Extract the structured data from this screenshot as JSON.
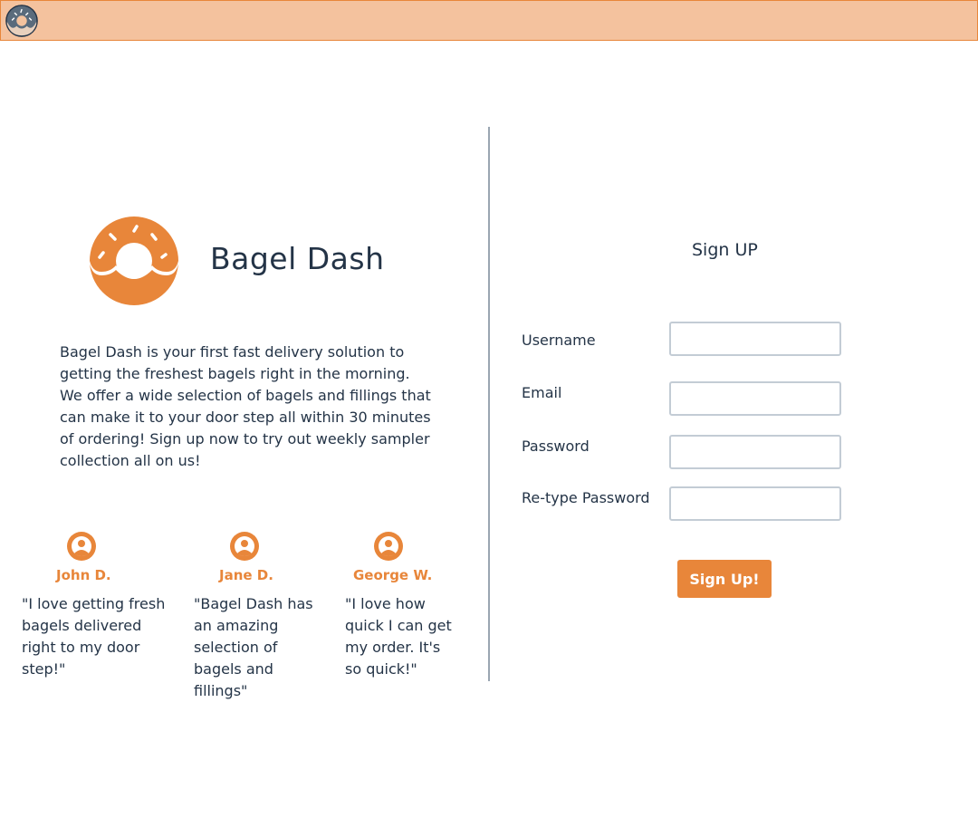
{
  "header": {
    "logo_icon": "donut-icon"
  },
  "brand": {
    "name": "Bagel Dash",
    "logo_icon": "donut-icon",
    "description": "Bagel Dash is your first fast delivery solution to getting the freshest bagels right in the morning. We offer a wide selection of bagels and fillings that can make it to your door step all within 30 minutes of ordering! Sign up now to try out weekly sampler collection all on us!"
  },
  "testimonials": [
    {
      "name": "John D.",
      "quote": "\"I love getting fresh bagels delivered right to my door step!\"",
      "icon": "user-avatar-icon"
    },
    {
      "name": "Jane D.",
      "quote": "\"Bagel Dash has an amazing selection of bagels and fillings\"",
      "icon": "user-avatar-icon"
    },
    {
      "name": "George W.",
      "quote": "\"I love how quick I can get my order. It's so quick!\"",
      "icon": "user-avatar-icon"
    }
  ],
  "signup": {
    "title": "Sign UP",
    "fields": [
      {
        "label": "Username",
        "value": "",
        "placeholder": ""
      },
      {
        "label": "Email",
        "value": "",
        "placeholder": ""
      },
      {
        "label": "Password",
        "value": "",
        "placeholder": ""
      },
      {
        "label": "Re-type Password",
        "value": "",
        "placeholder": ""
      }
    ],
    "submit_label": "Sign Up!"
  },
  "colors": {
    "accent": "#e8863a",
    "header_bg": "#f4c29e",
    "text": "#243447",
    "divider": "#9aa6b2",
    "input_border": "#c3ccd5"
  }
}
